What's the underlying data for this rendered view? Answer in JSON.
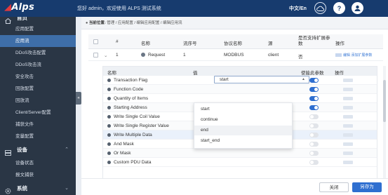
{
  "app": {
    "logo": "Alps",
    "welcome": "您好 admin，欢迎使用 ALPS 测试系统",
    "language": "中文/En"
  },
  "sidebar": {
    "top_group_label": "首页",
    "items": [
      {
        "label": "应用配置"
      },
      {
        "label": "应用流"
      },
      {
        "label": "DDoS攻击配置"
      },
      {
        "label": "DDoS攻击流"
      },
      {
        "label": "安全攻击"
      },
      {
        "label": "回放配置"
      },
      {
        "label": "回放流"
      },
      {
        "label": "Client/Server配置"
      },
      {
        "label": "捕获文件"
      },
      {
        "label": "变量配置"
      }
    ],
    "group_device": {
      "label": "设备"
    },
    "device_items": [
      {
        "label": "设备状态"
      },
      {
        "label": "报文捕获"
      }
    ],
    "group_system": {
      "label": "系统"
    }
  },
  "breadcrumb": {
    "prefix": "当前位置:",
    "path": "管理 / 应用配置 / 编辑应用配置 / 编辑应用流"
  },
  "table": {
    "headers": {
      "num": "#",
      "name": "名称",
      "seq": "流序号",
      "protocol": "协议名称",
      "source": "源",
      "expand": "是否支持扩展参数",
      "ops": "操作"
    },
    "row": {
      "num": "1",
      "name": "Request",
      "seq": "1",
      "protocol": "MODBUS",
      "source": "client",
      "expand": "否",
      "op_edit": "编辑",
      "op_add": "添加扩展参数"
    }
  },
  "subtable": {
    "headers": {
      "name": "名称",
      "value": "值",
      "use_param": "使能此参数",
      "ops": "操作"
    },
    "rows": [
      {
        "name": "Transaction Flag",
        "value": "start",
        "enabled": true
      },
      {
        "name": "Function Code",
        "value": "",
        "enabled": true
      },
      {
        "name": "Quantity of Items",
        "value": "",
        "enabled": true
      },
      {
        "name": "Starting Address",
        "value": "",
        "enabled": true
      },
      {
        "name": "Write Single Coil Value",
        "value": "",
        "enabled": false
      },
      {
        "name": "Write Single Register Value",
        "value": "",
        "enabled": false
      },
      {
        "name": "Write Multiple Data",
        "value": "",
        "enabled": false
      },
      {
        "name": "And Mask",
        "value": "",
        "enabled": false
      },
      {
        "name": "Or Mask",
        "value": "",
        "enabled": false
      },
      {
        "name": "Custom PDU Data",
        "value": "",
        "enabled": false
      }
    ]
  },
  "dropdown": {
    "options": [
      "start",
      "continue",
      "end",
      "start_end"
    ],
    "highlighted": "end"
  },
  "footer": {
    "close_label": "关闭",
    "saveas_label": "另存为"
  },
  "colors": {
    "topbar": "#173b6e",
    "sidebar": "#2a3645",
    "active": "#3e6ea8",
    "accent": "#2f6fd0"
  }
}
